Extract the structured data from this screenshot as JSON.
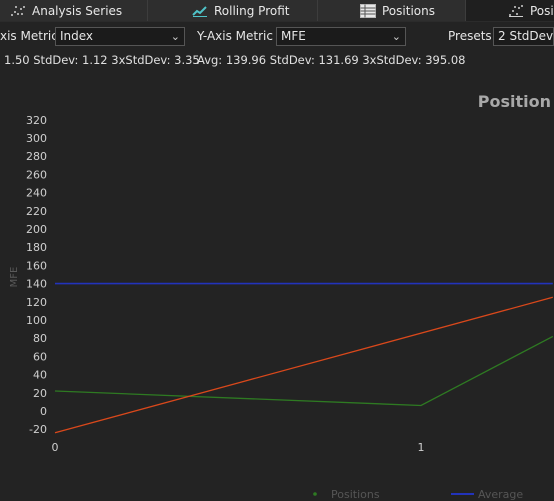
{
  "tabs": [
    {
      "label": "Analysis Series",
      "icon": "analysis-series-icon"
    },
    {
      "label": "Rolling Profit",
      "icon": "rolling-profit-icon"
    },
    {
      "label": "Positions",
      "icon": "positions-table-icon"
    },
    {
      "label": "Posit",
      "icon": "position-scatter-icon"
    }
  ],
  "toolbar": {
    "x_metric_label": "xis Metric",
    "x_metric_value": "Index",
    "y_metric_label": "Y-Axis Metric",
    "y_metric_value": "MFE",
    "presets_label": "Presets",
    "presets_value": "2 StdDev"
  },
  "stats": {
    "x": "1.50  StdDev: 1.12  3xStdDev: 3.35",
    "y": "Avg: 139.96  StdDev: 131.69  3xStdDev: 395.08"
  },
  "chart_data": {
    "type": "line",
    "title": "Position",
    "ylabel": "MFE",
    "xlabel": "",
    "x_ticks": [
      0,
      1
    ],
    "y_ticks": [
      -20,
      0,
      20,
      40,
      60,
      80,
      100,
      120,
      140,
      160,
      180,
      200,
      220,
      240,
      260,
      280,
      300,
      320
    ],
    "ylim": [
      -20,
      320
    ],
    "series": [
      {
        "name": "Positions",
        "color": "#2e7a22",
        "style": "line",
        "x": [
          0,
          1,
          1.36
        ],
        "y": [
          22,
          6,
          82
        ]
      },
      {
        "name": "Average",
        "color": "#2233bb",
        "style": "hline",
        "x": [
          0,
          1.36
        ],
        "y": [
          139.96,
          139.96
        ]
      },
      {
        "color": "#d9481b",
        "style": "line",
        "x": [
          0,
          1.36
        ],
        "y": [
          -24,
          125
        ]
      }
    ],
    "legend": {
      "placement": "bottom",
      "entries": [
        "Positions",
        "Average"
      ]
    }
  },
  "colors": {
    "background": "#232323",
    "tab_bar": "#2b2b2b",
    "input_background": "#1b1b1b",
    "axis_text": "#cfcfcf",
    "legend_text": "#555555"
  }
}
